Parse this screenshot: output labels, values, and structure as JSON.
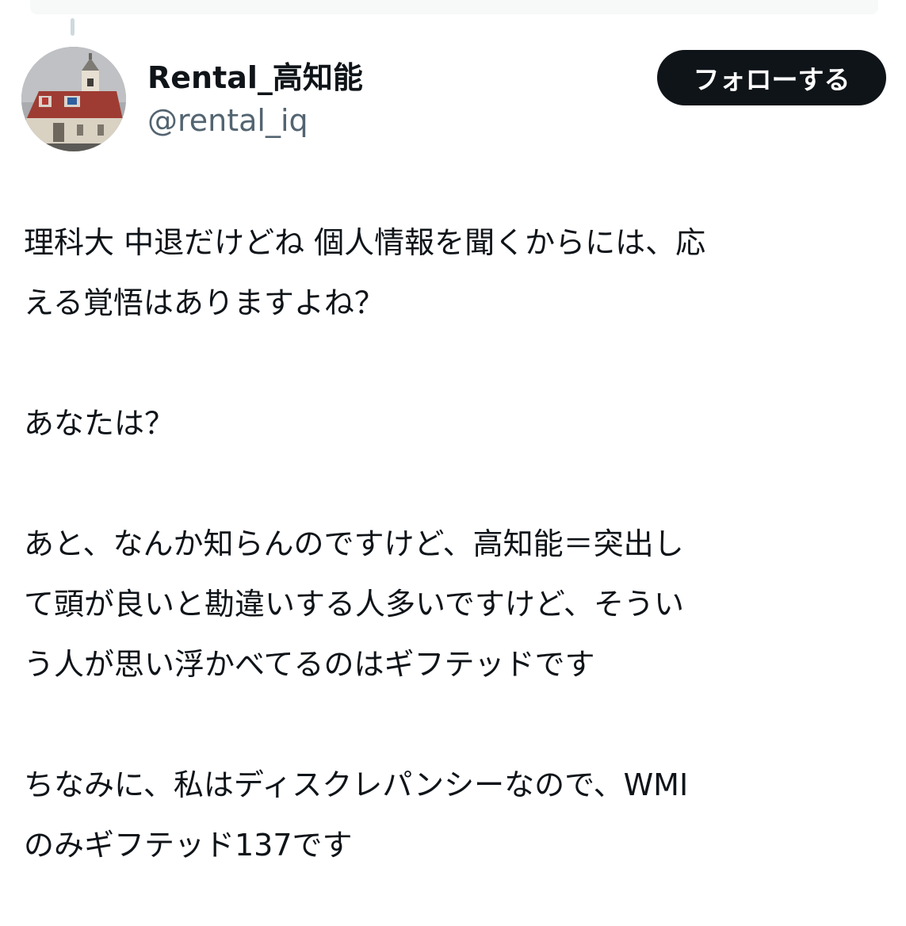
{
  "author": {
    "display_name": "Rental_高知能",
    "handle": "@rental_iq"
  },
  "follow_button": {
    "label": "フォローする"
  },
  "tweet": {
    "lines": [
      "理科大 中退だけどね  個人情報を聞くからには、応",
      "える覚悟はありますよね？",
      "",
      "あなたは？",
      "",
      "あと、なんか知らんのですけど、高知能＝突出し",
      "て頭が良いと勘違いする人多いですけど、そうい",
      "う人が思い浮かべてるのはギフテッドです",
      "",
      "ちなみに、私はディスクレパンシーなので、WMI",
      "のみギフテッド137です"
    ]
  },
  "icons": {
    "avatar": "church-photo-avatar",
    "thread": "thread-connector-line"
  }
}
